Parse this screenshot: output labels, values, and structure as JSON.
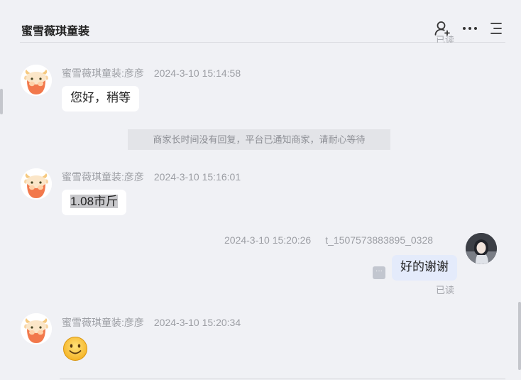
{
  "header": {
    "title": "蜜雪薇琪童装"
  },
  "scrolled_status": "已读",
  "system_notice": "商家长时间没有回复，平台已通知商家，请耐心等待",
  "messages": [
    {
      "sender": "蜜雪薇琪童装:彦彦",
      "time": "2024-3-10 15:14:58",
      "text": "您好，稍等",
      "direction": "incoming"
    },
    {
      "sender": "蜜雪薇琪童装:彦彦",
      "time": "2024-3-10 15:16:01",
      "text": "1.08市斤",
      "direction": "incoming",
      "selected": true
    },
    {
      "sender": "t_1507573883895_0328",
      "time": "2024-3-10 15:20:26",
      "text": "好的谢谢",
      "direction": "outgoing",
      "status": "已读"
    },
    {
      "sender": "蜜雪薇琪童装:彦彦",
      "time": "2024-3-10 15:20:34",
      "emoji": "slightly-smiling-face",
      "direction": "incoming"
    }
  ],
  "colors": {
    "background": "#f0f1f5",
    "incoming_bubble": "#ffffff",
    "outgoing_bubble": "#e4ebfb",
    "meta_text": "#9c9ea4",
    "mascot_orange": "#f2784b"
  }
}
